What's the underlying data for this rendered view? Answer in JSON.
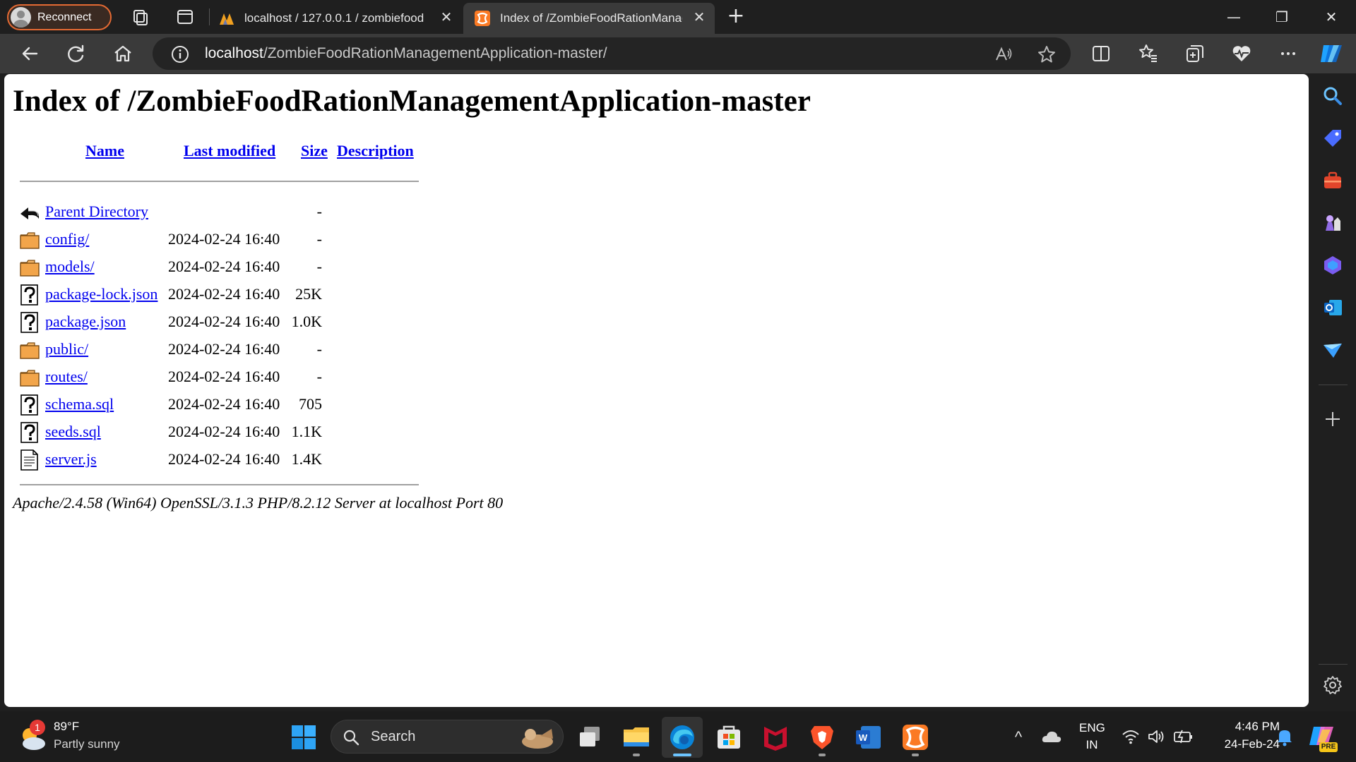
{
  "titlebar": {
    "reconnect_label": "Reconnect",
    "tabs": [
      {
        "label": "localhost / 127.0.0.1 / zombiefood"
      },
      {
        "label": "Index of /ZombieFoodRationManagementApplication-master"
      }
    ],
    "new_tab_glyph": "+",
    "close_glyph": "✕",
    "minimize_glyph": "—",
    "restore_glyph": "❐",
    "window_close_glyph": "✕"
  },
  "addressbar": {
    "url_host": "localhost",
    "url_path": "/ZombieFoodRationManagementApplication-master/"
  },
  "page": {
    "title": "Index of /ZombieFoodRationManagementApplication-master",
    "columns": {
      "name": "Name",
      "modified": "Last modified",
      "size": "Size",
      "description": "Description"
    },
    "rows": [
      {
        "name": "Parent Directory",
        "modified": "",
        "size": "-",
        "icon": "back-icon"
      },
      {
        "name": "config/",
        "modified": "2024-02-24 16:40",
        "size": "-",
        "icon": "folder-icon"
      },
      {
        "name": "models/",
        "modified": "2024-02-24 16:40",
        "size": "-",
        "icon": "folder-icon"
      },
      {
        "name": "package-lock.json",
        "modified": "2024-02-24 16:40",
        "size": "25K",
        "icon": "unknown-file-icon"
      },
      {
        "name": "package.json",
        "modified": "2024-02-24 16:40",
        "size": "1.0K",
        "icon": "unknown-file-icon"
      },
      {
        "name": "public/",
        "modified": "2024-02-24 16:40",
        "size": "-",
        "icon": "folder-icon"
      },
      {
        "name": "routes/",
        "modified": "2024-02-24 16:40",
        "size": "-",
        "icon": "folder-icon"
      },
      {
        "name": "schema.sql",
        "modified": "2024-02-24 16:40",
        "size": "705",
        "icon": "unknown-file-icon"
      },
      {
        "name": "seeds.sql",
        "modified": "2024-02-24 16:40",
        "size": "1.1K",
        "icon": "unknown-file-icon"
      },
      {
        "name": "server.js",
        "modified": "2024-02-24 16:40",
        "size": "1.4K",
        "icon": "text-file-icon"
      }
    ],
    "server_signature": "Apache/2.4.58 (Win64) OpenSSL/3.1.3 PHP/8.2.12 Server at localhost Port 80"
  },
  "taskbar": {
    "weather_temp": "89°F",
    "weather_desc": "Partly sunny",
    "weather_badge": "1",
    "search_label": "Search",
    "lang_top": "ENG",
    "lang_bottom": "IN",
    "time": "4:46 PM",
    "date": "24-Feb-24",
    "chevron_glyph": "^",
    "copilot_badge": "PRE"
  },
  "colors": {
    "link": "#0000ee",
    "accent_orange": "#e46a33",
    "xampp_orange": "#fb7a24",
    "edge_blue": "#0a84d8"
  }
}
